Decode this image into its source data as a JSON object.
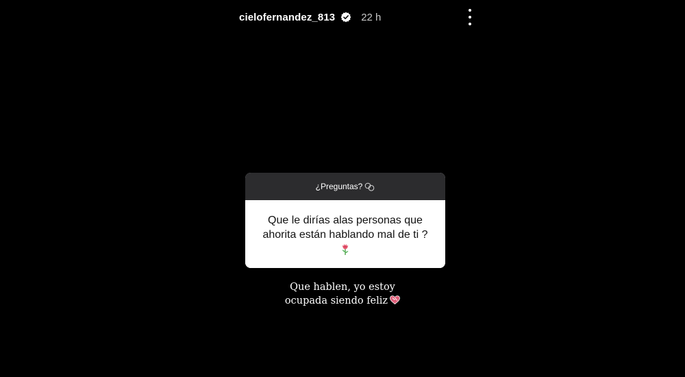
{
  "header": {
    "username": "cielofernandez_813",
    "timestamp": "22 h",
    "verified_icon": "verified-badge-icon",
    "menu_icon": "more-vertical-icon"
  },
  "sticker": {
    "title": "¿Preguntas?",
    "title_icon": "chat-bubbles-icon",
    "question_line1": "Que le dirías alas personas que",
    "question_line2": "ahorita están hablando mal de ti ?",
    "emoji_icon": "rose-icon"
  },
  "answer": {
    "line1": "Que hablen, yo estoy",
    "line2": "ocupada siendo feliz",
    "emoji_icon": "heart-icon"
  },
  "colors": {
    "background": "#000000",
    "sticker_header": "#2c2c2e",
    "sticker_body": "#ffffff",
    "heart": "#e0607a"
  }
}
